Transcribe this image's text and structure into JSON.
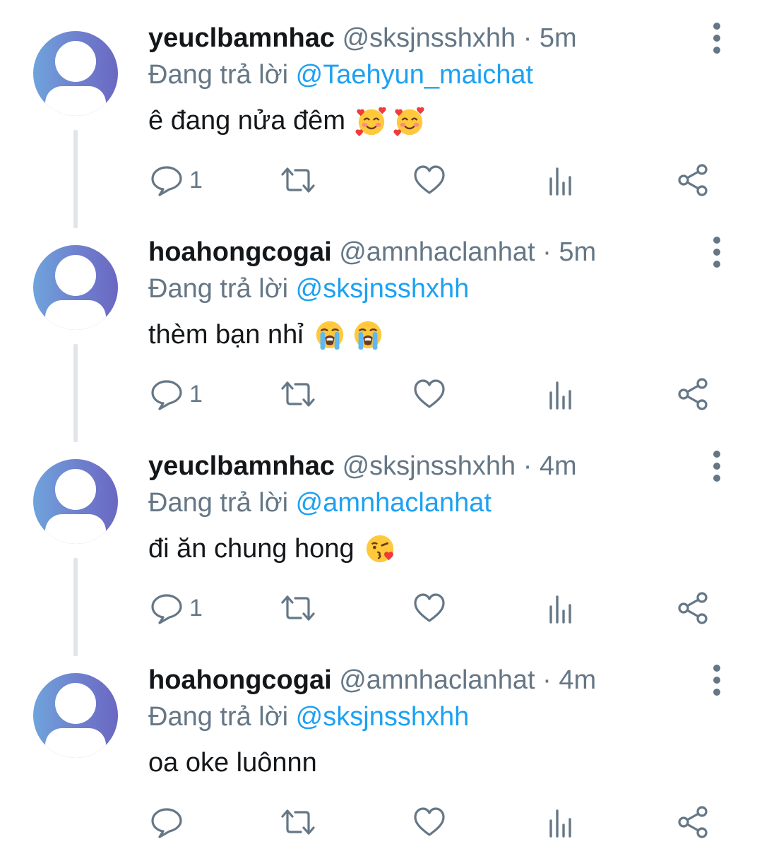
{
  "reply_prefix": "Đang trả lời",
  "colors": {
    "accent": "#1da1f2",
    "muted": "#657786",
    "text": "#14171a",
    "thread": "#e1e4e8"
  },
  "tweets": [
    {
      "name": "yeuclbamnhac",
      "handle": "@sksjnsshxhh",
      "separator": "·",
      "time": "5m",
      "reply_to": "@Taehyun_maichat",
      "text": "ê đang nửa đêm",
      "emojis": [
        "smiling-face-with-hearts",
        "smiling-face-with-hearts"
      ],
      "reply_count": "1"
    },
    {
      "name": "hoahongcogai",
      "handle": "@amnhaclanhat",
      "separator": "·",
      "time": "5m",
      "reply_to": "@sksjnsshxhh",
      "text": "thèm bạn nhỉ",
      "emojis": [
        "loudly-crying-face",
        "loudly-crying-face"
      ],
      "reply_count": "1"
    },
    {
      "name": "yeuclbamnhac",
      "handle": "@sksjnsshxhh",
      "separator": "·",
      "time": "4m",
      "reply_to": "@amnhaclanhat",
      "text": "đi ăn chung hong",
      "emojis": [
        "face-blowing-a-kiss"
      ],
      "reply_count": "1"
    },
    {
      "name": "hoahongcogai",
      "handle": "@amnhaclanhat",
      "separator": "·",
      "time": "4m",
      "reply_to": "@sksjnsshxhh",
      "text": "oa oke luônnn",
      "emojis": [],
      "reply_count": ""
    }
  ],
  "action_icons": [
    "reply-icon",
    "retweet-icon",
    "like-icon",
    "analytics-icon",
    "share-icon"
  ]
}
